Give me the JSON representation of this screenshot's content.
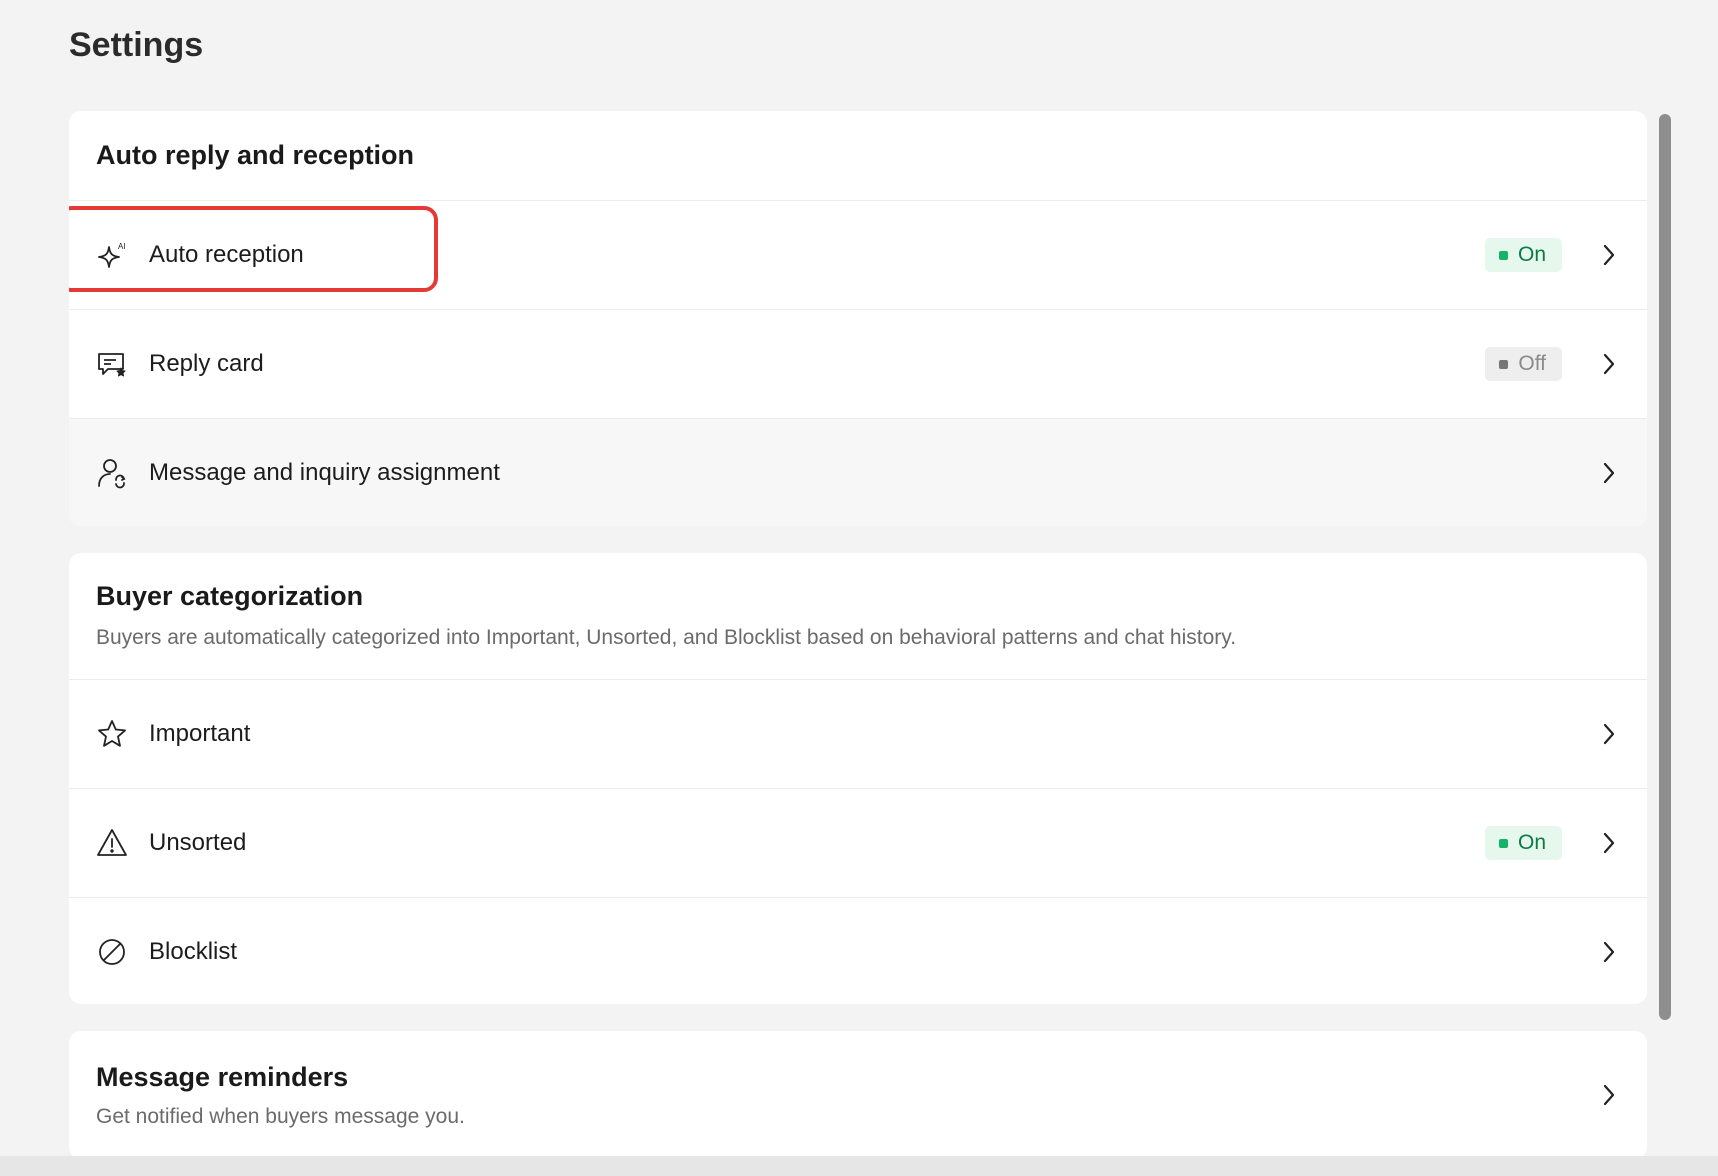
{
  "page": {
    "title": "Settings"
  },
  "auto_reply": {
    "title": "Auto reply and reception",
    "items": [
      {
        "label": "Auto reception",
        "status": "On",
        "icon": "ai-sparkle-icon"
      },
      {
        "label": "Reply card",
        "status": "Off",
        "icon": "reply-card-icon"
      },
      {
        "label": "Message and inquiry assignment",
        "icon": "user-assign-icon"
      }
    ]
  },
  "buyer": {
    "title": "Buyer categorization",
    "description": "Buyers are automatically categorized into Important, Unsorted, and Blocklist based on behavioral patterns and chat history.",
    "items": [
      {
        "label": "Important",
        "icon": "star-icon"
      },
      {
        "label": "Unsorted",
        "status": "On",
        "icon": "warning-icon"
      },
      {
        "label": "Blocklist",
        "icon": "block-icon"
      }
    ]
  },
  "reminders": {
    "title": "Message reminders",
    "description": "Get notified when buyers message you."
  },
  "colors": {
    "on_bg": "#e6f7ee",
    "on_text": "#0d7a43",
    "on_dot": "#17b26a",
    "off_bg": "#eeeeee",
    "off_text": "#8a8a8a",
    "highlight": "#e53935"
  }
}
